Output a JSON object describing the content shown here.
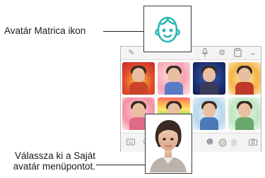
{
  "callouts": {
    "avatar_sticker_icon": "Avatár Matrica ikon",
    "select_own_avatar_line1": "Válassza ki a Saját",
    "select_own_avatar_line2": "avatár menüpontot."
  },
  "colors": {
    "accent_teal": "#2bb9b3",
    "highlight_border": "#3a3a3a",
    "panel_border": "#b9b9b9"
  },
  "toolbar_icons": [
    "handwriting-icon",
    "microphone-icon",
    "settings-icon",
    "clipboard-icon",
    "collapse-chevron-icon"
  ],
  "sticker_tiles": [
    {
      "name": "sticker-fire"
    },
    {
      "name": "sticker-heart-pink"
    },
    {
      "name": "sticker-night-sky"
    },
    {
      "name": "sticker-surprise-red"
    },
    {
      "name": "sticker-pink-hearts"
    },
    {
      "name": "sticker-rainbow"
    },
    {
      "name": "sticker-snow"
    },
    {
      "name": "sticker-peace"
    }
  ],
  "bottom_icons": [
    "keyboard-icon",
    "emoji-icon",
    "avatar-thumb-icon",
    "sticker-pack-icon",
    "camera-icon"
  ]
}
